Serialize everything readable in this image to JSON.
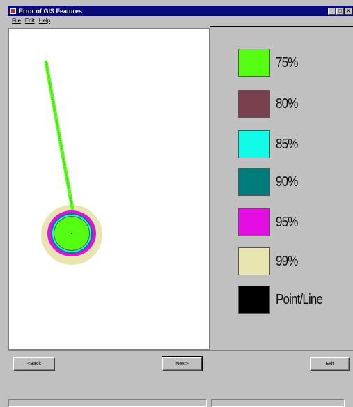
{
  "window": {
    "title": "Error of GIS Features"
  },
  "menu": {
    "items": [
      "File",
      "Edit",
      "Help"
    ]
  },
  "legend": [
    {
      "label": "75%",
      "color": "#55ff11"
    },
    {
      "label": "80%",
      "color": "#7a404e"
    },
    {
      "label": "85%",
      "color": "#11fce8"
    },
    {
      "label": "90%",
      "color": "#007c7c"
    },
    {
      "label": "95%",
      "color": "#e40ee4"
    },
    {
      "label": "99%",
      "color": "#e8e5b0"
    },
    {
      "label": "Point/Line",
      "color": "#000000"
    }
  ],
  "buttons": {
    "back": "<Back",
    "next": "Next>",
    "exit": "Exit"
  }
}
